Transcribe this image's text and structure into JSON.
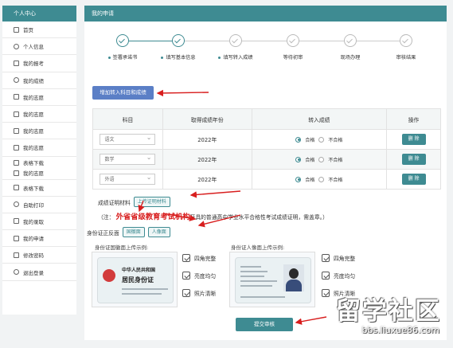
{
  "sidebar": {
    "title": "个人中心",
    "items": [
      {
        "label": "首页",
        "icon": "home-icon"
      },
      {
        "label": "个人信息",
        "icon": "user-icon"
      },
      {
        "label": "我的报考",
        "icon": "id-card-icon"
      },
      {
        "label": "我的成绩",
        "icon": "clock-icon"
      },
      {
        "label": "我的志愿",
        "icon": "edit-icon"
      },
      {
        "label": "我的志愿",
        "icon": "edit-icon"
      },
      {
        "label": "我的志愿",
        "icon": "edit-icon"
      },
      {
        "label": "我的志愿",
        "icon": "edit-icon"
      },
      {
        "label": "表格下载",
        "label2": "我的志愿",
        "icon": "download-icon"
      },
      {
        "label": "表格下载",
        "icon": "download-icon"
      },
      {
        "label": "自助打印",
        "icon": "printer-icon"
      },
      {
        "label": "我的录取",
        "icon": "list-icon"
      },
      {
        "label": "我的申请",
        "icon": "edit-icon"
      },
      {
        "label": "修改密码",
        "icon": "lock-icon"
      },
      {
        "label": "退出登录",
        "icon": "logout-icon"
      }
    ]
  },
  "main": {
    "title": "我的申请",
    "steps": [
      {
        "label": "签署承诺书",
        "done": true
      },
      {
        "label": "填写基本信息",
        "done": true
      },
      {
        "label": "填写转入成绩",
        "done": false
      },
      {
        "label": "等待初审",
        "done": false
      },
      {
        "label": "现场办理",
        "done": false
      },
      {
        "label": "审核结果",
        "done": false
      }
    ],
    "add_button": "增加转入科目和成绩",
    "table": {
      "headers": [
        "科目",
        "取得成绩年份",
        "转入成绩",
        "操作"
      ],
      "rows": [
        {
          "subject": "语文",
          "year": "2022年",
          "pass": "合格",
          "fail": "不合格",
          "action": "删 除"
        },
        {
          "subject": "数学",
          "year": "2022年",
          "pass": "合格",
          "fail": "不合格",
          "action": "删 除"
        },
        {
          "subject": "外语",
          "year": "2022年",
          "pass": "合格",
          "fail": "不合格",
          "action": "删 除"
        }
      ]
    },
    "materials": {
      "label": "成绩证明材料",
      "upload_button": "上传证明材料"
    },
    "note": {
      "prefix": "（注：",
      "highlight": "外省省级教育考试机构",
      "suffix": "开具的普通高中学业水平合格性考试成绩证明，需盖章。）"
    },
    "id_card": {
      "label": "身份证正反面",
      "front_button": "国徽面",
      "back_button": "人像面"
    },
    "examples": {
      "front": {
        "label": "身份证国徽面上传示例:",
        "card_line1": "中华人民共和国",
        "card_line2": "居民身份证",
        "checks": [
          "四角完整",
          "亮度均匀",
          "照片清晰"
        ]
      },
      "back": {
        "label": "身份证人像面上传示例:",
        "checks": [
          "四角完整",
          "亮度均匀",
          "照片清晰"
        ]
      }
    },
    "submit_button": "提交审核"
  },
  "watermark": {
    "big": "留学社区",
    "small": "bbs.liuxue86.com"
  },
  "colors": {
    "teal": "#3e8b92",
    "blue": "#5b7fc6",
    "annotation_red": "#d81e1e"
  }
}
